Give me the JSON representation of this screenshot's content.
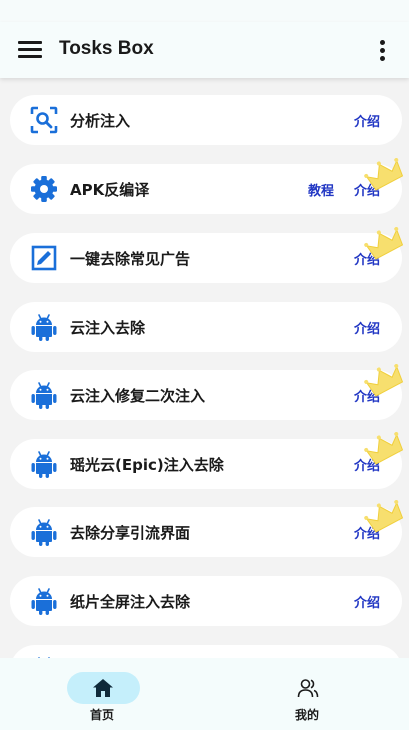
{
  "app": {
    "title": "Tosks Box"
  },
  "items": [
    {
      "label": "分析注入",
      "icon": "scan-search-icon",
      "intro": "介绍"
    },
    {
      "label": "APK反编译",
      "icon": "gear-icon",
      "tutorial": "教程",
      "intro": "介绍"
    },
    {
      "label": "一键去除常见广告",
      "icon": "edit-box-icon",
      "intro": "介绍"
    },
    {
      "label": "云注入去除",
      "icon": "android-icon",
      "intro": "介绍"
    },
    {
      "label": "云注入修复二次注入",
      "icon": "android-icon",
      "intro": "介绍"
    },
    {
      "label": "瑶光云(Epic)注入去除",
      "icon": "android-icon",
      "intro": "介绍"
    },
    {
      "label": "去除分享引流界面",
      "icon": "android-icon",
      "intro": "介绍"
    },
    {
      "label": "纸片全屏注入去除",
      "icon": "android-icon",
      "intro": "介绍"
    }
  ],
  "bottom_nav": {
    "home_label": "首页",
    "mine_label": "我的"
  },
  "colors": {
    "accent": "#2237c4",
    "icon_blue": "#1a6fd9",
    "crown": "#f7df6e",
    "nav_active": "#c5effb"
  }
}
